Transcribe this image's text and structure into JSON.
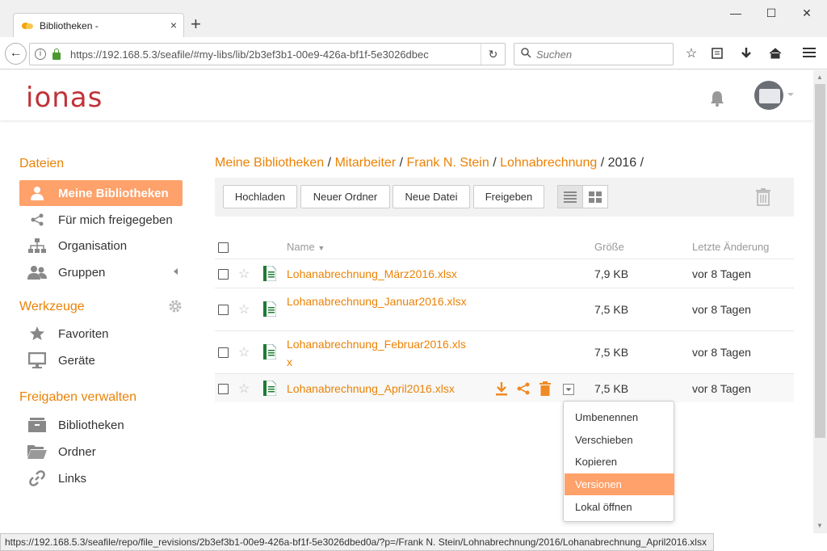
{
  "browser": {
    "tab_title": "Bibliotheken -",
    "tab_close": "×",
    "new_tab": "+",
    "window_controls": {
      "minimize": "—",
      "maximize": "☐",
      "close": "✕"
    },
    "url": "https://192.168.5.3/seafile/#my-libs/lib/2b3ef3b1-00e9-426a-bf1f-5e3026dbec",
    "search_placeholder": "Suchen",
    "status_url": "https://192.168.5.3/seafile/repo/file_revisions/2b3ef3b1-00e9-426a-bf1f-5e3026dbed0a/?p=/Frank N. Stein/Lohnabrechnung/2016/Lohanabrechnung_April2016.xlsx"
  },
  "header": {
    "logo": "ionas"
  },
  "sidebar": {
    "dateien_heading": "Dateien",
    "dateien_items": [
      {
        "label": "Meine Bibliotheken",
        "icon": "user-icon",
        "active": true
      },
      {
        "label": "Für mich freigegeben",
        "icon": "share-icon"
      },
      {
        "label": "Organisation",
        "icon": "org-icon"
      },
      {
        "label": "Gruppen",
        "icon": "group-icon"
      }
    ],
    "werkzeuge_heading": "Werkzeuge",
    "werkzeuge_items": [
      {
        "label": "Favoriten",
        "icon": "star-icon"
      },
      {
        "label": "Geräte",
        "icon": "monitor-icon"
      }
    ],
    "freigaben_heading": "Freigaben verwalten",
    "freigaben_items": [
      {
        "label": "Bibliotheken",
        "icon": "library-icon"
      },
      {
        "label": "Ordner",
        "icon": "folder-icon"
      },
      {
        "label": "Links",
        "icon": "link-icon"
      }
    ]
  },
  "breadcrumb": {
    "items": [
      "Meine Bibliotheken",
      "Mitarbeiter",
      "Frank N. Stein",
      "Lohnabrechnung"
    ],
    "current": "2016",
    "separator": "/"
  },
  "toolbar": {
    "upload": "Hochladen",
    "new_folder": "Neuer Ordner",
    "new_file": "Neue Datei",
    "share": "Freigeben"
  },
  "table": {
    "col_name": "Name",
    "col_size": "Größe",
    "col_modified": "Letzte Änderung",
    "rows": [
      {
        "name": "Lohanabrechnung_März2016.xlsx",
        "size": "7,9 KB",
        "modified": "vor 8 Tagen"
      },
      {
        "name": "Lohanabrechnung_Januar2016.xlsx",
        "size": "7,5 KB",
        "modified": "vor 8 Tagen"
      },
      {
        "name": "Lohanabrechnung_Februar2016.xlsx",
        "size": "7,5 KB",
        "modified": "vor 8 Tagen"
      },
      {
        "name": "Lohanabrechnung_April2016.xlsx",
        "size": "7,5 KB",
        "modified": "vor 8 Tagen"
      }
    ]
  },
  "context_menu": {
    "items": [
      "Umbenennen",
      "Verschieben",
      "Kopieren",
      "Versionen",
      "Lokal öffnen"
    ],
    "active_index": 3
  },
  "colors": {
    "accent": "#eb8205",
    "active_bg": "#fea16a",
    "logo": "#c03238"
  }
}
